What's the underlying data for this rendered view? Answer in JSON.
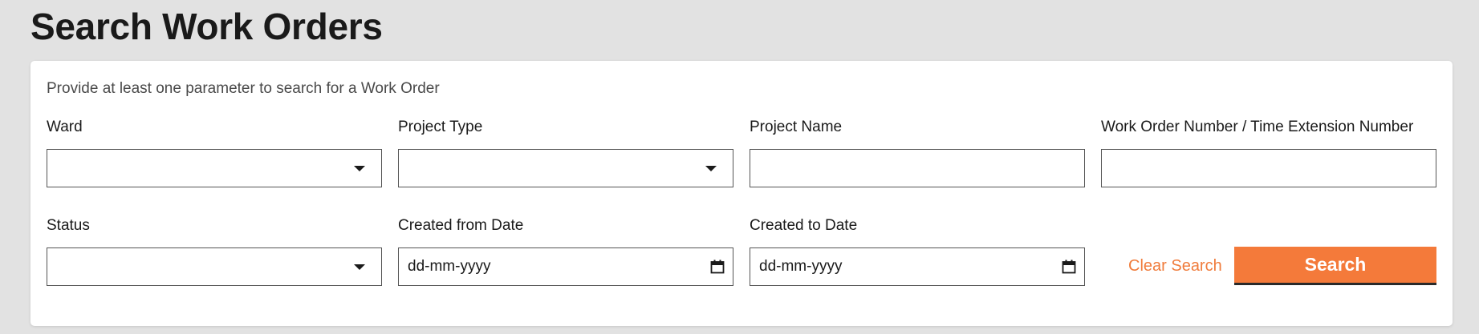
{
  "page": {
    "title": "Search Work Orders"
  },
  "form": {
    "hint": "Provide at least one parameter to search for a Work Order",
    "ward": {
      "label": "Ward",
      "value": ""
    },
    "project_type": {
      "label": "Project Type",
      "value": ""
    },
    "project_name": {
      "label": "Project Name",
      "value": ""
    },
    "work_order_number": {
      "label": "Work Order Number / Time Extension Number",
      "value": ""
    },
    "status": {
      "label": "Status",
      "value": ""
    },
    "created_from": {
      "label": "Created from Date",
      "value": "dd-mm-yyyy"
    },
    "created_to": {
      "label": "Created to Date",
      "value": "dd-mm-yyyy"
    }
  },
  "actions": {
    "clear_label": "Clear Search",
    "search_label": "Search"
  },
  "colors": {
    "accent": "#f47a3a",
    "link": "#f07c3c",
    "background": "#e2e2e2"
  },
  "icons": {
    "select": "chevron-down-icon",
    "date": "calendar-icon"
  }
}
